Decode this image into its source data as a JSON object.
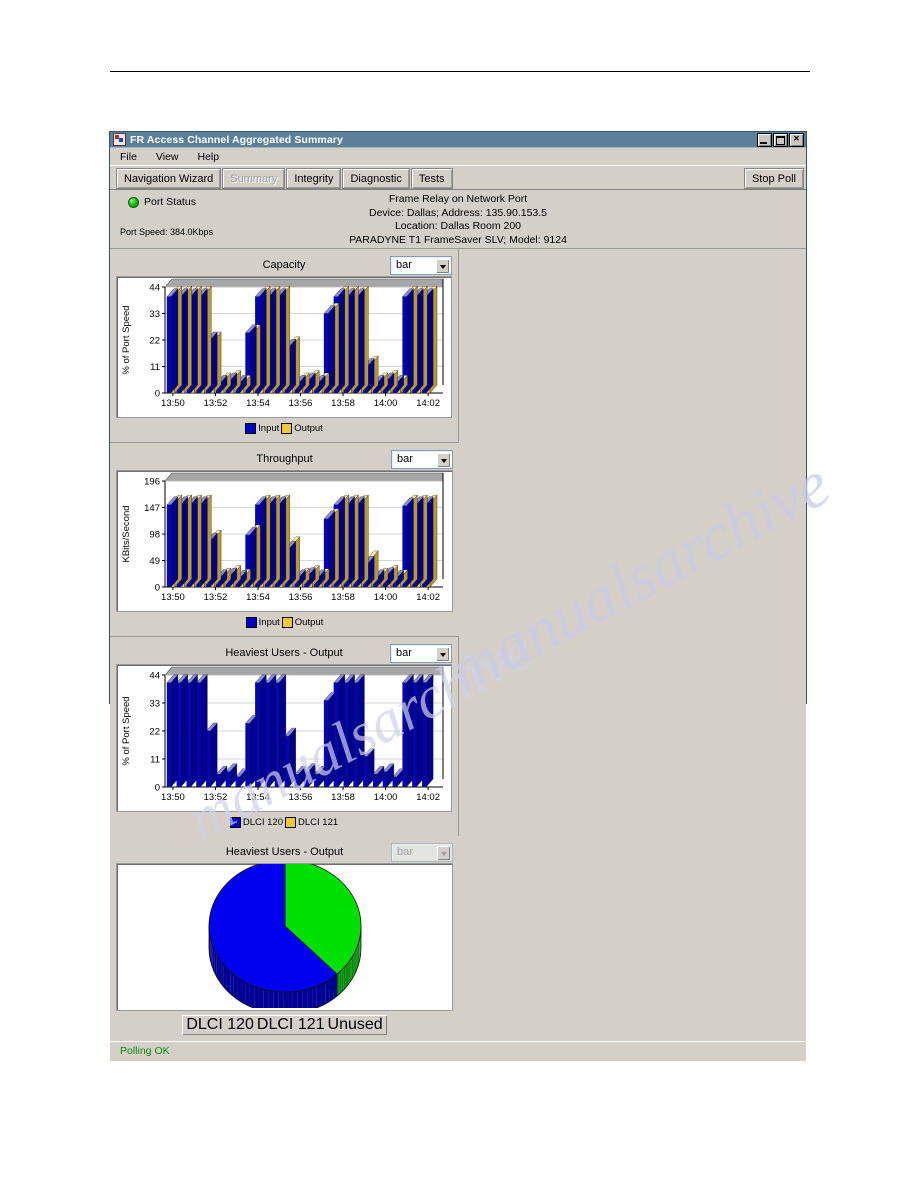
{
  "window": {
    "title": "FR Access Channel Aggregated Summary",
    "icon": "app-icon",
    "controls": {
      "minimize": "_",
      "maximize": "□",
      "close": "×"
    }
  },
  "menubar": {
    "items": [
      "File",
      "View",
      "Help"
    ]
  },
  "toolbar": {
    "tabs": [
      {
        "label": "Navigation Wizard",
        "enabled": true
      },
      {
        "label": "Summary",
        "enabled": false
      },
      {
        "label": "Integrity",
        "enabled": true
      },
      {
        "label": "Diagnostic",
        "enabled": true
      },
      {
        "label": "Tests",
        "enabled": true
      }
    ],
    "action_label": "Stop Poll"
  },
  "info": {
    "port_status_label": "Port Status",
    "port_status_color": "#12c412",
    "port_speed": "Port Speed: 384.0Kbps",
    "lines": [
      "Frame Relay on Network Port",
      "Device: Dallas; Address: 135.90.153.5",
      "Location: Dallas Room 200",
      "PARADYNE T1 FrameSaver SLV; Model: 9124"
    ]
  },
  "status": {
    "text": "Polling OK",
    "color": "#0a8a0a"
  },
  "panels": [
    {
      "title": "Capacity",
      "chart_type_value": "bar",
      "chart_type_enabled": true
    },
    {
      "title": "Throughput",
      "chart_type_value": "bar",
      "chart_type_enabled": true
    },
    {
      "title": "Heaviest Users - Output",
      "chart_type_value": "bar",
      "chart_type_enabled": true
    },
    {
      "title": "Heaviest Users - Output",
      "chart_type_value": "bar",
      "chart_type_enabled": false
    }
  ],
  "chart_data": [
    {
      "id": "capacity",
      "type": "bar",
      "title": "Capacity",
      "xlabel": "",
      "ylabel": "% of Port Speed",
      "ylim": [
        0,
        44
      ],
      "yticks": [
        0,
        11,
        22,
        33,
        44
      ],
      "xticks": [
        "13:50",
        "13:52",
        "13:54",
        "13:56",
        "13:58",
        "14:00",
        "14:02"
      ],
      "grid": true,
      "legend": [
        "Input",
        "Output"
      ],
      "legend_colors": [
        "#0000cc",
        "#f2c832"
      ],
      "legend_position": "bottom",
      "series": [
        {
          "name": "Input",
          "color": "#0000cc",
          "values": [
            40,
            40,
            40,
            40,
            22,
            4,
            5,
            4,
            25,
            40,
            40,
            40,
            19,
            4,
            5,
            4,
            33,
            40,
            40,
            40,
            11,
            4,
            5,
            4,
            40,
            40,
            40
          ]
        },
        {
          "name": "Output",
          "color": "#f2c832",
          "values": [
            41,
            41,
            41,
            41,
            22,
            5,
            6,
            4,
            25,
            41,
            41,
            41,
            20,
            5,
            6,
            5,
            34,
            41,
            41,
            41,
            12,
            5,
            6,
            4,
            41,
            41,
            41
          ]
        }
      ]
    },
    {
      "id": "throughput",
      "type": "bar",
      "title": "Throughput",
      "xlabel": "",
      "ylabel": "KBits/Second",
      "ylim": [
        0,
        196
      ],
      "yticks": [
        0,
        49,
        98,
        147,
        196
      ],
      "xticks": [
        "13:50",
        "13:52",
        "13:54",
        "13:56",
        "13:58",
        "14:00",
        "14:02"
      ],
      "grid": true,
      "legend": [
        "Input",
        "Output"
      ],
      "legend_colors": [
        "#0000cc",
        "#f2c832"
      ],
      "legend_position": "bottom",
      "series": [
        {
          "name": "Input",
          "color": "#0000cc",
          "values": [
            152,
            152,
            152,
            152,
            85,
            17,
            20,
            16,
            96,
            152,
            152,
            152,
            70,
            17,
            21,
            17,
            126,
            152,
            152,
            152,
            42,
            17,
            21,
            16,
            150,
            152,
            152
          ]
        },
        {
          "name": "Output",
          "color": "#f2c832",
          "values": [
            155,
            155,
            155,
            155,
            90,
            20,
            25,
            18,
            100,
            155,
            155,
            155,
            78,
            20,
            25,
            19,
            130,
            155,
            155,
            155,
            52,
            20,
            25,
            17,
            155,
            155,
            155
          ]
        }
      ]
    },
    {
      "id": "heaviest-users-output-bar",
      "type": "bar",
      "title": "Heaviest Users - Output",
      "xlabel": "",
      "ylabel": "% of Port Speed",
      "ylim": [
        0,
        44
      ],
      "yticks": [
        0,
        11,
        22,
        33,
        44
      ],
      "xticks": [
        "13:50",
        "13:52",
        "13:54",
        "13:56",
        "13:58",
        "14:00",
        "14:02"
      ],
      "grid": true,
      "legend": [
        "DLCI 120",
        "DLCI 121"
      ],
      "legend_colors": [
        "#0000cc",
        "#f2c832"
      ],
      "legend_position": "bottom",
      "series": [
        {
          "name": "DLCI 120",
          "color": "#0000cc",
          "values": [
            41,
            41,
            41,
            41,
            22,
            5,
            6,
            4,
            25,
            41,
            41,
            41,
            20,
            5,
            6,
            5,
            34,
            41,
            41,
            41,
            12,
            5,
            6,
            4,
            41,
            41,
            41
          ]
        },
        {
          "name": "DLCI 121",
          "color": "#f2c832",
          "values": [
            0,
            0,
            0,
            0,
            0,
            0,
            0,
            0,
            0,
            0,
            0,
            0,
            0,
            0,
            0,
            0,
            0,
            0,
            0,
            0,
            0,
            0,
            0,
            0,
            0,
            0,
            0
          ]
        }
      ]
    },
    {
      "id": "heaviest-users-output-pie",
      "type": "pie",
      "title": "Heaviest Users - Output",
      "legend": [
        "DLCI 120",
        "DLCI 121",
        "Unused"
      ],
      "legend_colors": [
        "#00e000",
        "#ff0000",
        "#0000ee"
      ],
      "legend_position": "bottom",
      "labels": [
        "DLCI 120",
        "DLCI 121",
        "Unused"
      ],
      "values": [
        38,
        0,
        62
      ]
    }
  ]
}
